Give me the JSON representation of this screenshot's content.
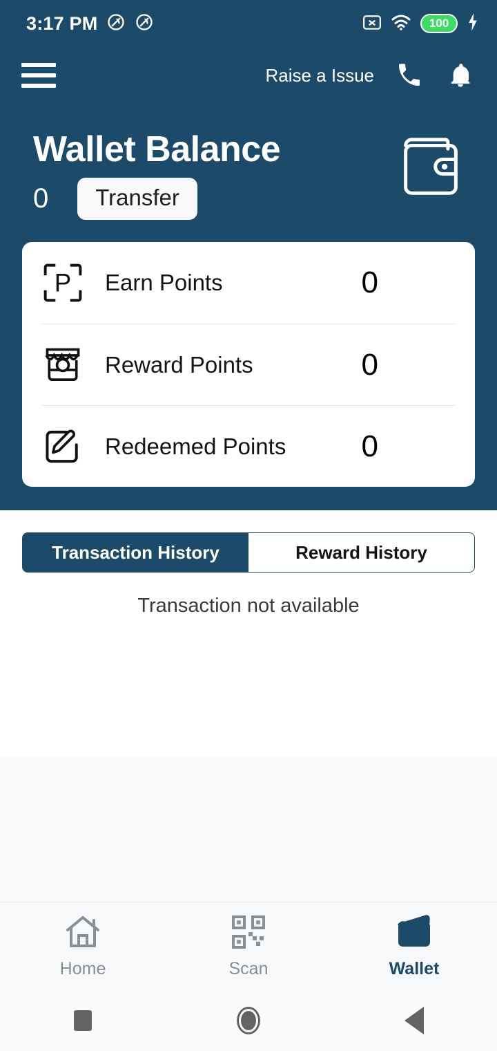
{
  "status_bar": {
    "time": "3:17 PM",
    "notification_icons": [
      "dnd-icon",
      "dnd-icon"
    ],
    "no_sim_icon": "no-sim-icon",
    "wifi_icon": "wifi-icon",
    "battery_level": "100",
    "charging_icon": "charging-bolt-icon",
    "battery_color": "#3ddc64"
  },
  "app_bar": {
    "menu_icon": "hamburger-menu-icon",
    "raise_issue_label": "Raise a Issue",
    "call_icon": "phone-icon",
    "notification_icon": "bell-icon"
  },
  "wallet": {
    "title": "Wallet Balance",
    "balance": "0",
    "transfer_label": "Transfer",
    "wallet_icon": "wallet-icon"
  },
  "points": [
    {
      "icon": "scan-p-icon",
      "label": "Earn Points",
      "value": "0"
    },
    {
      "icon": "shop-icon",
      "label": "Reward Points",
      "value": "0"
    },
    {
      "icon": "edit-note-icon",
      "label": "Redeemed Points",
      "value": "0"
    }
  ],
  "history": {
    "tabs": [
      {
        "label": "Transaction History",
        "active": true
      },
      {
        "label": "Reward History",
        "active": false
      }
    ],
    "empty_message": "Transaction not available"
  },
  "bottom_nav": [
    {
      "icon": "home-icon",
      "label": "Home",
      "active": false
    },
    {
      "icon": "qr-scan-icon",
      "label": "Scan",
      "active": false
    },
    {
      "icon": "wallet-icon",
      "label": "Wallet",
      "active": true
    }
  ],
  "android_nav": {
    "recents": "recents-square-icon",
    "home": "home-circle-icon",
    "back": "back-triangle-icon"
  },
  "theme": {
    "primary": "#1c4b69",
    "page_bg": "#f7f8fa",
    "card_bg": "#ffffff"
  }
}
